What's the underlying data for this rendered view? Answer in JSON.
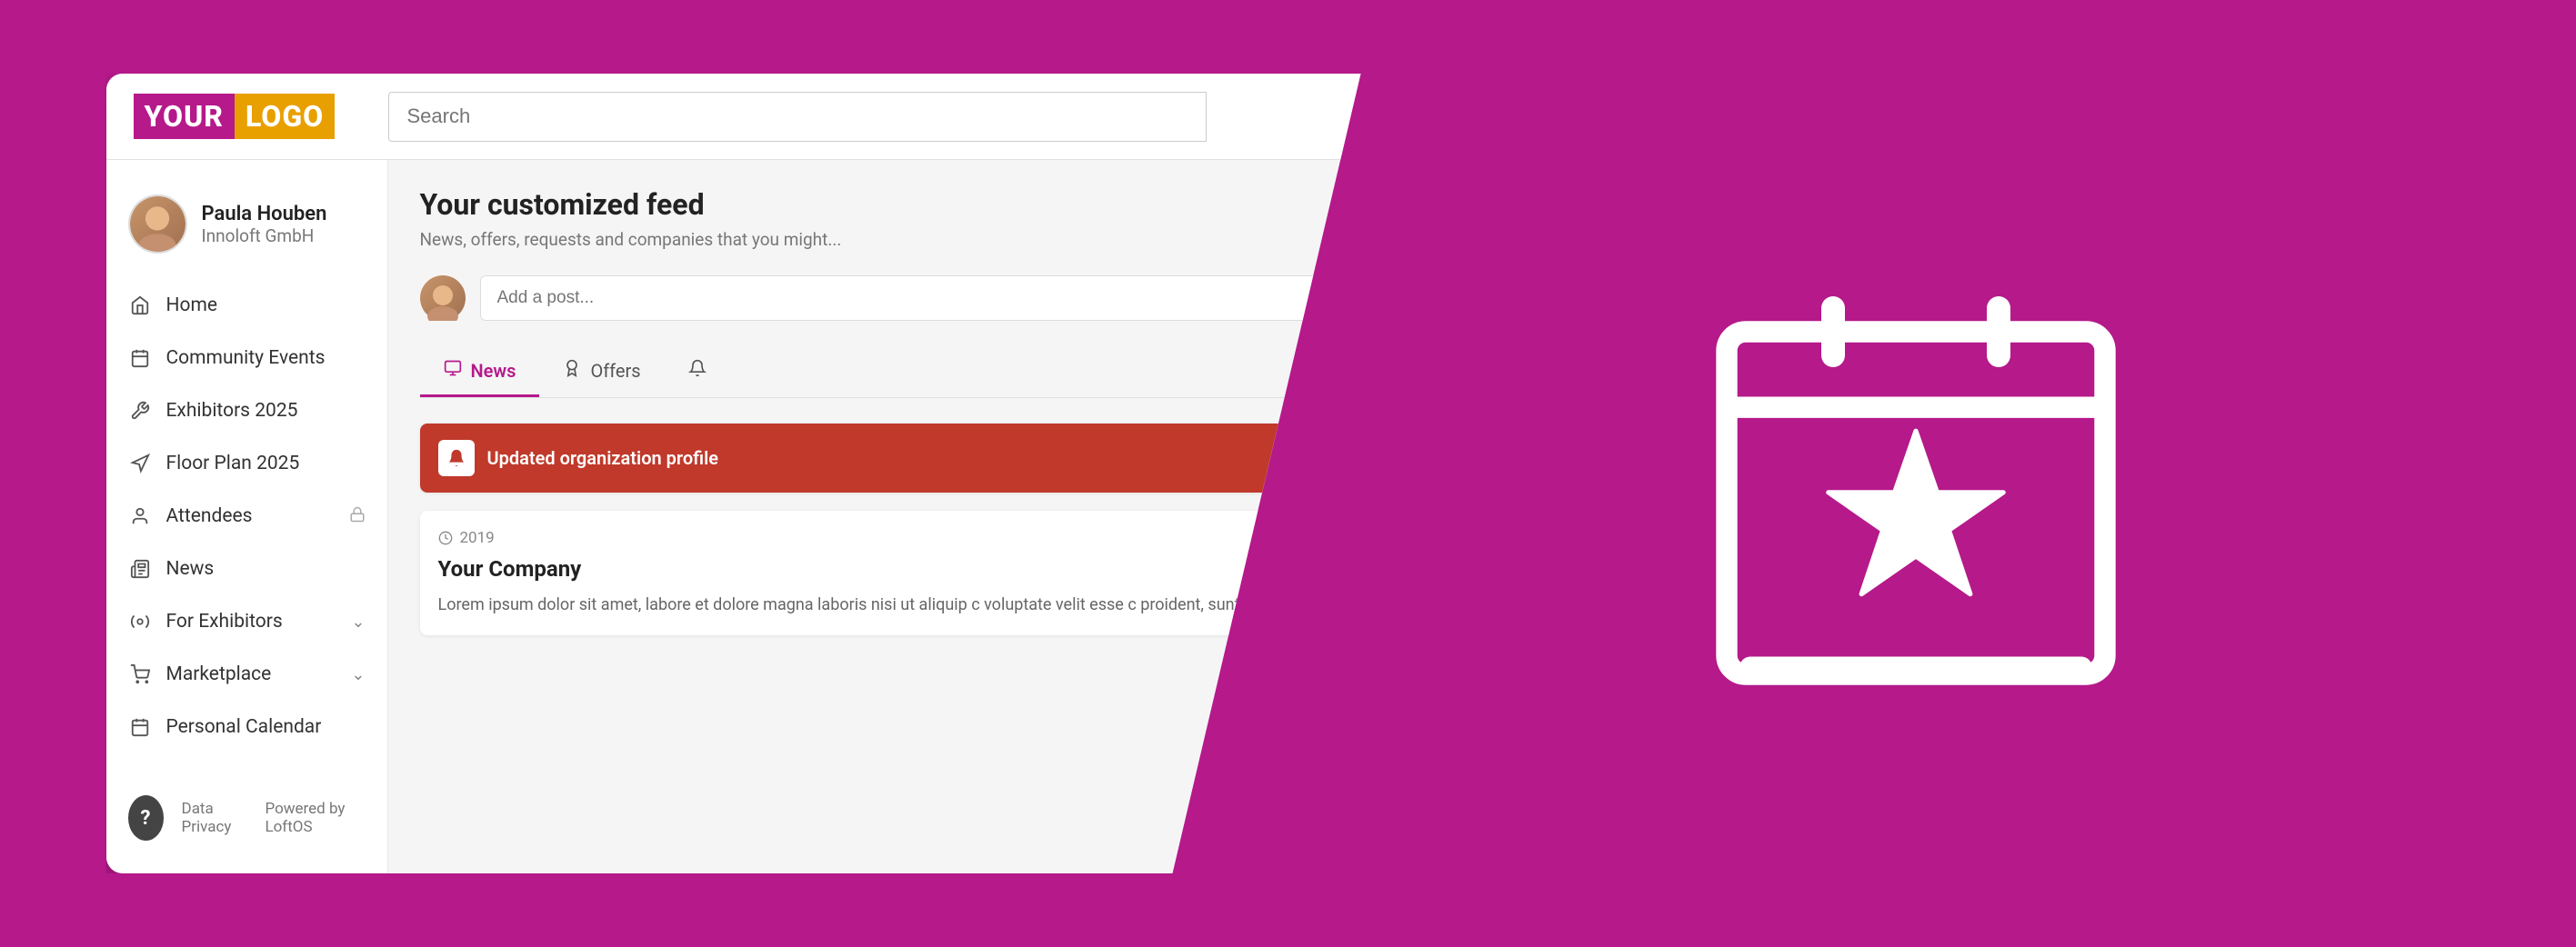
{
  "logo": {
    "your": "YOUR",
    "logo": "LOGO"
  },
  "search": {
    "placeholder": "Search"
  },
  "user": {
    "name": "Paula Houben",
    "company": "Innoloft GmbH"
  },
  "nav": {
    "items": [
      {
        "id": "home",
        "label": "Home",
        "icon": "🏠",
        "hasChevron": false,
        "hasLock": false
      },
      {
        "id": "community-events",
        "label": "Community Events",
        "icon": "📅",
        "hasChevron": false,
        "hasLock": false
      },
      {
        "id": "exhibitors-2025",
        "label": "Exhibitors 2025",
        "icon": "✂️",
        "hasChevron": false,
        "hasLock": false
      },
      {
        "id": "floor-plan-2025",
        "label": "Floor Plan 2025",
        "icon": "🗺️",
        "hasChevron": false,
        "hasLock": false
      },
      {
        "id": "attendees",
        "label": "Attendees",
        "icon": "👤",
        "hasChevron": false,
        "hasLock": true
      },
      {
        "id": "news",
        "label": "News",
        "icon": "📰",
        "hasChevron": false,
        "hasLock": false
      },
      {
        "id": "for-exhibitors",
        "label": "For Exhibitors",
        "icon": "⚙️",
        "hasChevron": true,
        "hasLock": false
      },
      {
        "id": "marketplace",
        "label": "Marketplace",
        "icon": "🛒",
        "hasChevron": true,
        "hasLock": false
      },
      {
        "id": "personal-calendar",
        "label": "Personal Calendar",
        "icon": "📆",
        "hasChevron": false,
        "hasLock": false
      }
    ]
  },
  "footer": {
    "help_label": "?",
    "data_privacy": "Data Privacy",
    "powered_by": "Powered by LoftOS"
  },
  "feed": {
    "title": "Your customized feed",
    "subtitle": "News, offers, requests and companies that you might...",
    "post_placeholder": "Add a post...",
    "tabs": [
      {
        "id": "news",
        "label": "News",
        "icon": "📰",
        "active": true
      },
      {
        "id": "offers",
        "label": "Offers",
        "icon": "🎁",
        "active": false
      },
      {
        "id": "third",
        "label": "",
        "icon": "📢",
        "active": false
      }
    ],
    "notification_card": {
      "title": "Updated organization profile",
      "icon": "🔔"
    },
    "post_card": {
      "year": "2019",
      "company": "Your Company",
      "text": "Lorem ipsum dolor sit amet, labore et dolore magna laboris nisi ut aliquip c voluptate velit esse c proident, sunt in cul"
    }
  }
}
